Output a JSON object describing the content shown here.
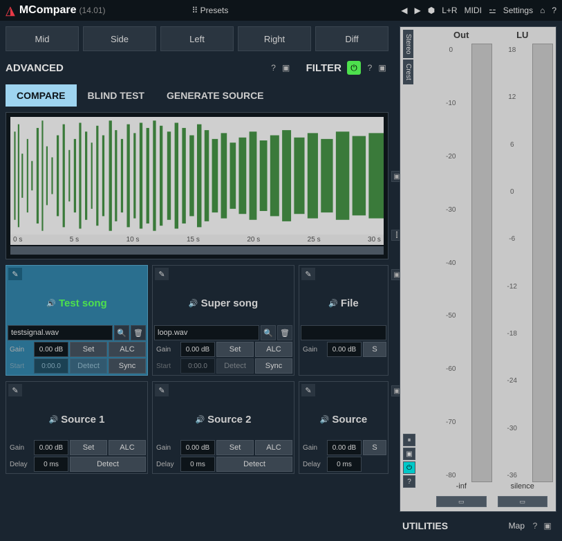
{
  "app": {
    "title": "MCompare",
    "version": "(14.01)"
  },
  "topbar": {
    "presets": "Presets",
    "channels": "L+R",
    "midi": "MIDI",
    "settings": "Settings"
  },
  "modes": {
    "mid": "Mid",
    "side": "Side",
    "left": "Left",
    "right": "Right",
    "diff": "Diff"
  },
  "advanced": {
    "label": "ADVANCED"
  },
  "filter": {
    "label": "FILTER"
  },
  "tabs": {
    "compare": "COMPARE",
    "blind": "BLIND TEST",
    "generate": "GENERATE SOURCE"
  },
  "waveform": {
    "times": [
      "0 s",
      "5 s",
      "10 s",
      "15 s",
      "20 s",
      "25 s",
      "30 s"
    ]
  },
  "slots_top": [
    {
      "title": "Test song",
      "file": "testsignal.wav",
      "gain": "0.00 dB",
      "start": "0:00.0",
      "active": true
    },
    {
      "title": "Super song",
      "file": "loop.wav",
      "gain": "0.00 dB",
      "start": "0:00.0",
      "active": false
    },
    {
      "title": "File",
      "file": "",
      "gain": "0.00 dB",
      "start": "",
      "active": false
    }
  ],
  "slots_bottom": [
    {
      "title": "Source 1",
      "gain": "0.00 dB",
      "delay": "0 ms"
    },
    {
      "title": "Source 2",
      "gain": "0.00 dB",
      "delay": "0 ms"
    },
    {
      "title": "Source",
      "gain": "0.00 dB",
      "delay": "0 ms"
    }
  ],
  "labels": {
    "gain": "Gain",
    "set": "Set",
    "alc": "ALC",
    "start": "Start",
    "detect": "Detect",
    "sync": "Sync",
    "delay": "Delay"
  },
  "meters": {
    "out": {
      "label": "Out",
      "scale": [
        "0",
        "-10",
        "-20",
        "-30",
        "-40",
        "-50",
        "-60",
        "-70",
        "-80"
      ],
      "value": "-inf"
    },
    "lu": {
      "label": "LU",
      "scale": [
        "18",
        "12",
        "6",
        "0",
        "-6",
        "-12",
        "-18",
        "-24",
        "-30",
        "-36"
      ],
      "value": "silence"
    },
    "sidetabs": {
      "stereo": "Stereo",
      "crest": "Crest"
    }
  },
  "utilities": {
    "label": "UTILITIES",
    "map": "Map"
  }
}
